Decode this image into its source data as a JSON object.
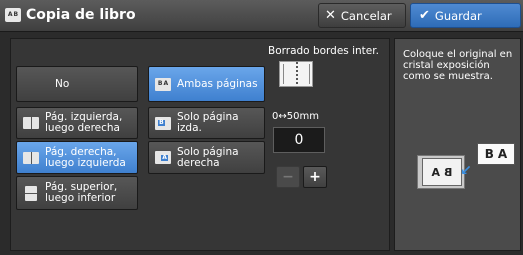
{
  "window": {
    "title": "Copia de libro",
    "cancel_label": "Cancelar",
    "save_label": "Guardar"
  },
  "options": {
    "no": "No",
    "left_then_right": "Pág. izquierda, luego derecha",
    "right_then_left": "Pág. derecha, luego izquierda",
    "top_then_bottom": "Pág. superior, luego inferior",
    "both_pages": "Ambas páginas",
    "left_only": "Solo página izda.",
    "right_only": "Solo página derecha"
  },
  "selected": {
    "binding": "right_then_left",
    "pages": "both_pages"
  },
  "erase": {
    "label": "Borrado bordes inter.",
    "range": "0↔50mm",
    "value": "0",
    "minus_glyph": "−",
    "plus_glyph": "+"
  },
  "instructions": {
    "text": "Coloque el original en cristal exposición como se muestra."
  },
  "illustration": {
    "glass_letters": [
      "A",
      "B"
    ],
    "output_letters": [
      "B",
      "A"
    ]
  },
  "colors": {
    "accent": "#3f80cf",
    "save": "#2e6cb7",
    "background": "#2b2b2b"
  },
  "icons": {
    "title": "book-copy-icon",
    "cancel": "x-icon",
    "save": "checkmark-icon"
  }
}
